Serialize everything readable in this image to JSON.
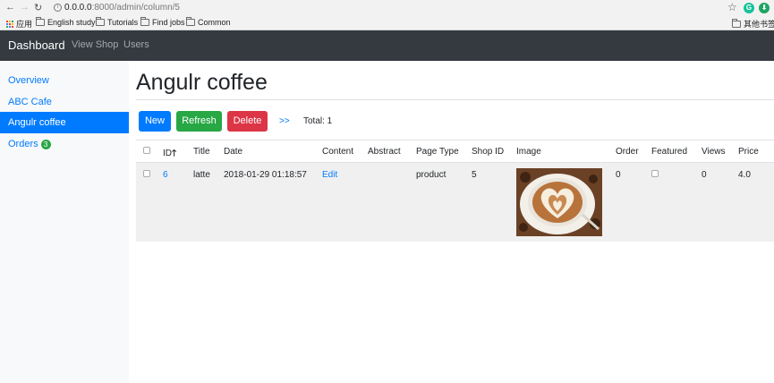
{
  "browser": {
    "url_host": "0.0.0.0",
    "url_rest": ":8000/admin/column/5",
    "bookmarks": [
      "应用",
      "English study",
      "Tutorials",
      "Find jobs",
      "Common"
    ],
    "other_bookmarks": "其他书签"
  },
  "navbar": {
    "brand": "Dashboard",
    "links": [
      "View Shop",
      "Users"
    ]
  },
  "sidebar": {
    "items": [
      {
        "label": "Overview"
      },
      {
        "label": "ABC Cafe"
      },
      {
        "label": "Angulr coffee"
      },
      {
        "label": "Orders"
      }
    ],
    "orders_badge": "3"
  },
  "main": {
    "title": "Angulr coffee",
    "buttons": {
      "new": "New",
      "refresh": "Refresh",
      "delete": "Delete"
    },
    "next": ">>",
    "total": "Total: 1",
    "columns": [
      "ID",
      "Title",
      "Date",
      "Content",
      "Abstract",
      "Page Type",
      "Shop ID",
      "Image",
      "Order",
      "Featured",
      "Views",
      "Price"
    ],
    "sort_indicator": "🡑",
    "rows": [
      {
        "id": "6",
        "title": "latte",
        "date": "2018-01-29 01:18:57",
        "content": "Edit",
        "abstract": "",
        "page_type": "product",
        "shop_id": "5",
        "order": "0",
        "views": "0",
        "price": "4.0"
      }
    ]
  },
  "colors": {
    "primary": "#007bff",
    "success": "#28a745",
    "danger": "#dc3545",
    "navbar": "#343a40"
  }
}
